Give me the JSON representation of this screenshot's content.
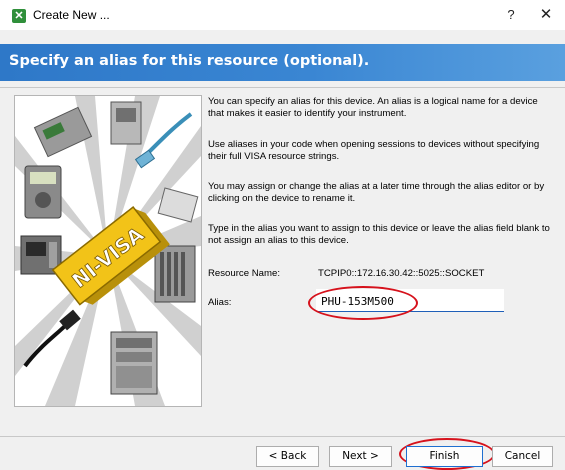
{
  "window": {
    "title": "Create New ...",
    "help_label": "?",
    "close_label": "✕"
  },
  "banner": {
    "title": "Specify an alias for this resource (optional)."
  },
  "illustration": {
    "logo_text": "NI-VISA"
  },
  "description": {
    "p1": "You can specify an alias for this device. An alias is a logical name for a device that makes it easier to identify your instrument.",
    "p2": "Use aliases in your code when opening sessions to devices without specifying their full VISA resource strings.",
    "p3": "You may assign or change the alias at a later time through the alias editor or by clicking on the device to rename it.",
    "p4": "Type in the alias you want to assign to this device or leave the alias field blank to not assign an alias to this device."
  },
  "resource": {
    "label": "Resource Name:",
    "value": "TCPIP0::172.16.30.42::5025::SOCKET"
  },
  "alias": {
    "label": "Alias:",
    "value": "PHU-153M500"
  },
  "buttons": {
    "back": "< Back",
    "next": "Next >",
    "finish": "Finish",
    "cancel": "Cancel"
  },
  "colors": {
    "banner": "#3a86d3",
    "annotation": "#d6121c",
    "logo_yellow": "#f2c318"
  }
}
